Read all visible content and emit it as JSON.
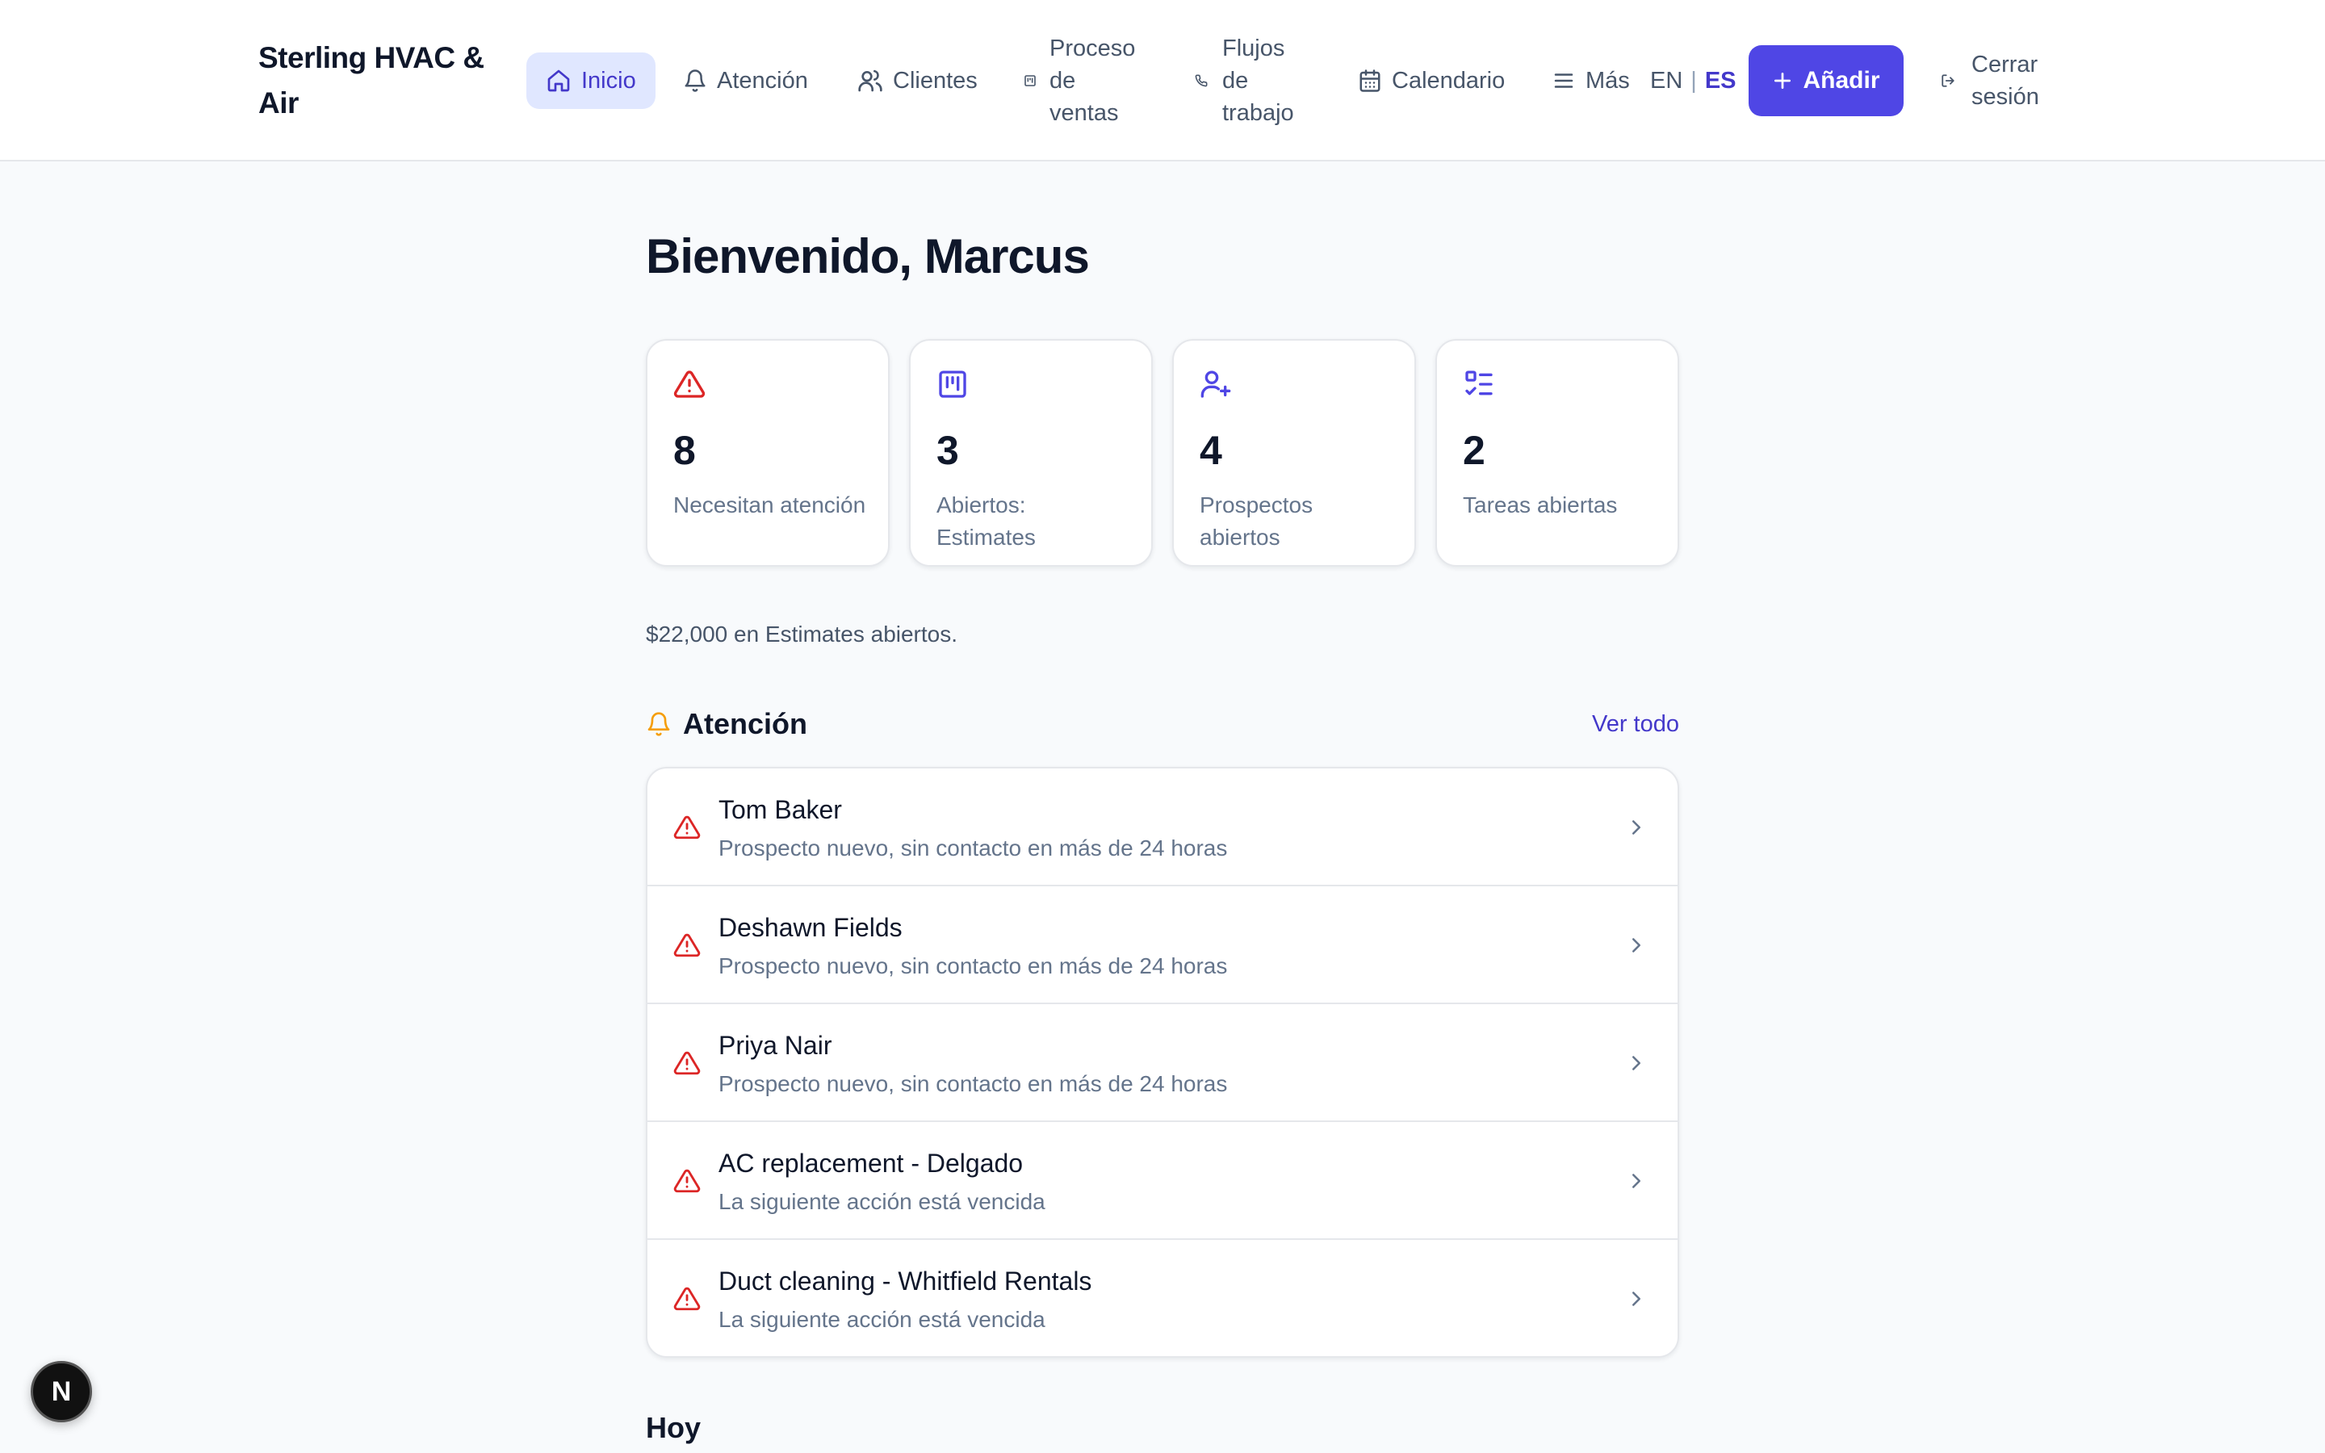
{
  "brand": {
    "name": "Sterling HVAC & Air"
  },
  "nav": {
    "home": "Inicio",
    "attention": "Atención",
    "clients": "Clientes",
    "sales_process": "Proceso de ventas",
    "workflows": "Flujos de trabajo",
    "calendar": "Calendario",
    "more": "Más"
  },
  "lang": {
    "en": "EN",
    "separator": "|",
    "es": "ES"
  },
  "actions": {
    "add": "Añadir",
    "logout": "Cerrar sesión"
  },
  "welcome": "Bienvenido, Marcus",
  "stats": [
    {
      "value": "8",
      "label": "Necesitan atención",
      "icon": "alert-triangle-icon",
      "color": "#dc2626"
    },
    {
      "value": "3",
      "label": "Abiertos: Estimates",
      "icon": "kanban-icon",
      "color": "#4f46e5"
    },
    {
      "value": "4",
      "label": "Prospectos abiertos",
      "icon": "user-plus-icon",
      "color": "#4f46e5"
    },
    {
      "value": "2",
      "label": "Tareas abiertas",
      "icon": "task-list-icon",
      "color": "#4f46e5"
    }
  ],
  "summary": "$22,000 en Estimates abiertos.",
  "attention_section": {
    "title": "Atención",
    "see_all": "Ver todo",
    "items": [
      {
        "name": "Tom Baker",
        "detail": "Prospecto nuevo, sin contacto en más de 24 horas"
      },
      {
        "name": "Deshawn Fields",
        "detail": "Prospecto nuevo, sin contacto en más de 24 horas"
      },
      {
        "name": "Priya Nair",
        "detail": "Prospecto nuevo, sin contacto en más de 24 horas"
      },
      {
        "name": "AC replacement - Delgado",
        "detail": "La siguiente acción está vencida"
      },
      {
        "name": "Duct cleaning - Whitfield Rentals",
        "detail": "La siguiente acción está vencida"
      }
    ]
  },
  "today_section": {
    "title": "Hoy"
  },
  "dev_badge": {
    "letter": "N"
  },
  "colors": {
    "accent": "#4f46e5",
    "danger": "#dc2626",
    "warning": "#f59e0b"
  }
}
